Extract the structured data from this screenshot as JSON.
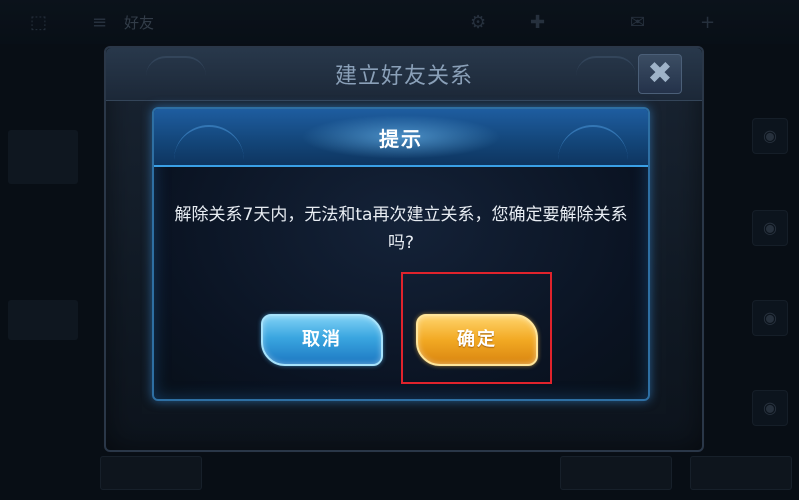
{
  "background": {
    "top_bar": {
      "tab_friends": "好友"
    }
  },
  "outer_dialog": {
    "title": "建立好友关系",
    "close_glyph": "✖"
  },
  "prompt_dialog": {
    "title": "提示",
    "message": "解除关系7天内，无法和ta再次建立关系，您确定要解除关系吗?",
    "cancel_label": "取消",
    "confirm_label": "确定"
  },
  "highlight": {
    "target": "confirm-button",
    "color": "#e0232c"
  },
  "colors": {
    "cancel_button": "#3aa6e0",
    "confirm_button": "#f2a923",
    "prompt_border": "#2e6fa3"
  }
}
